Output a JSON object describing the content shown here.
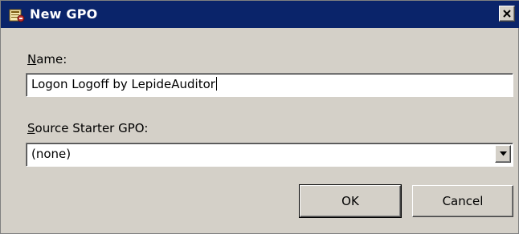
{
  "window": {
    "title": "New GPO",
    "icon": "gpo-icon",
    "close_icon": "close-icon"
  },
  "name_field": {
    "label_accel": "N",
    "label_rest": "ame:",
    "value": "Logon Logoff by LepideAuditor"
  },
  "source_field": {
    "label_accel": "S",
    "label_rest": "ource Starter GPO:",
    "value": "(none)",
    "arrow_icon": "chevron-down-icon"
  },
  "buttons": {
    "ok_label": "OK",
    "cancel_label": "Cancel"
  },
  "colors": {
    "titlebar": "#0a246a",
    "dialog_bg": "#d4d0c8"
  }
}
